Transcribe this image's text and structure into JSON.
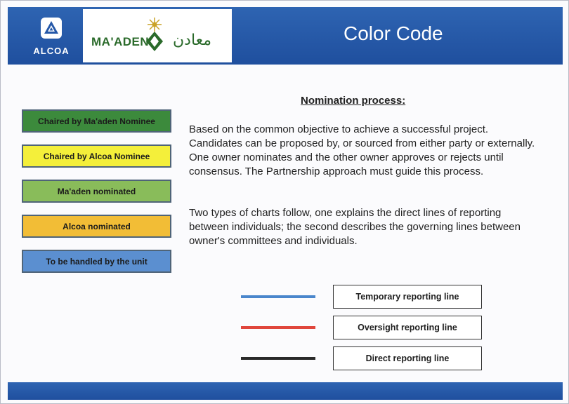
{
  "header": {
    "alcoa_logo_text": "ALCOA",
    "maaden_logo_text": "MA'ADEN",
    "maaden_logo_arabic": "معادن",
    "title": "Color Code",
    "band_color": "#2558a8"
  },
  "legend": [
    {
      "label": "Chaired by Ma'aden Nominee",
      "color": "#3c8a3c"
    },
    {
      "label": "Chaired by Alcoa Nominee",
      "color": "#f4ef3a"
    },
    {
      "label": "Ma'aden nominated",
      "color": "#89bc5a"
    },
    {
      "label": "Alcoa nominated",
      "color": "#f2bd36"
    },
    {
      "label": "To be handled by the unit",
      "color": "#5b8fd0"
    }
  ],
  "nomination": {
    "title": "Nomination process:",
    "paragraph1": "Based on the common objective to achieve a successful project. Candidates can be proposed by, or sourced from either party or externally. One owner nominates and the other owner approves or rejects until consensus. The Partnership approach must guide this process.",
    "paragraph2": "Two types of charts follow, one explains the direct lines of reporting between individuals; the second describes the governing lines between owner's committees and individuals."
  },
  "reporting_lines": [
    {
      "label": "Temporary reporting line",
      "color": "#4a86cc"
    },
    {
      "label": "Oversight reporting line",
      "color": "#e0463c"
    },
    {
      "label": "Direct reporting line",
      "color": "#2a2a2a"
    }
  ]
}
